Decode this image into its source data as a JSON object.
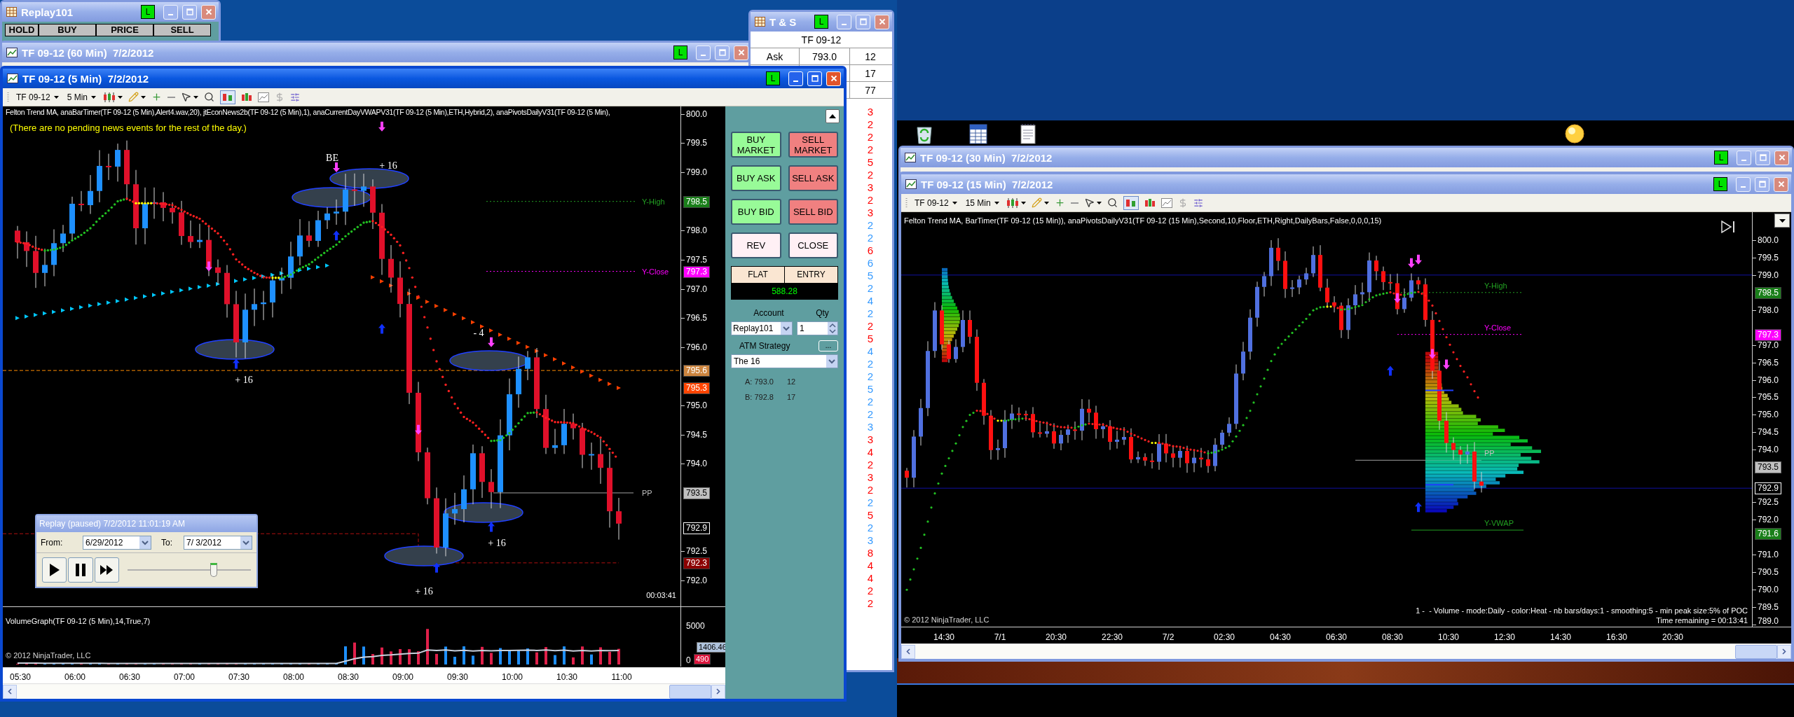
{
  "replay_account_window": {
    "title": "Replay101",
    "active": false,
    "link_button": "L",
    "columns": [
      "HOLD",
      "BUY",
      "PRICE",
      "SELL"
    ]
  },
  "chart_60min_window": {
    "title": "TF 09-12 (60 Min)  7/2/2012",
    "active": false,
    "link_button": "L"
  },
  "time_and_sales_window": {
    "title": "T & S",
    "active": false,
    "link_button": "L",
    "instrument": "TF 09-12",
    "quotes": [
      {
        "side": "Ask",
        "price": "793.0",
        "size": "12"
      },
      {
        "size": "17"
      },
      {
        "size": "77"
      }
    ],
    "trades": [
      {
        "size": "3",
        "color": "#ff0000"
      },
      {
        "size": "2",
        "color": "#ff0000"
      },
      {
        "size": "2",
        "color": "#ff0000"
      },
      {
        "size": "2",
        "color": "#ff0000"
      },
      {
        "size": "5",
        "color": "#ff0000"
      },
      {
        "size": "2",
        "color": "#ff0000"
      },
      {
        "size": "3",
        "color": "#ff0000"
      },
      {
        "size": "2",
        "color": "#ff0000"
      },
      {
        "size": "3",
        "color": "#ff0000"
      },
      {
        "size": "2",
        "color": "#3399ff"
      },
      {
        "size": "2",
        "color": "#3399ff"
      },
      {
        "size": "6",
        "color": "#ff0000"
      },
      {
        "size": "6",
        "color": "#3399ff"
      },
      {
        "size": "5",
        "color": "#3399ff"
      },
      {
        "size": "2",
        "color": "#3399ff"
      },
      {
        "size": "4",
        "color": "#3399ff"
      },
      {
        "size": "2",
        "color": "#3399ff"
      },
      {
        "size": "2",
        "color": "#ff0000"
      },
      {
        "size": "5",
        "color": "#ff0000"
      },
      {
        "size": "4",
        "color": "#3399ff"
      },
      {
        "size": "2",
        "color": "#3399ff"
      },
      {
        "size": "2",
        "color": "#3399ff"
      },
      {
        "size": "5",
        "color": "#3399ff"
      },
      {
        "size": "2",
        "color": "#3399ff"
      },
      {
        "size": "2",
        "color": "#3399ff"
      },
      {
        "size": "3",
        "color": "#3399ff"
      },
      {
        "size": "3",
        "color": "#ff0000"
      },
      {
        "size": "4",
        "color": "#ff0000"
      },
      {
        "size": "2",
        "color": "#ff0000"
      },
      {
        "size": "3",
        "color": "#ff0000"
      },
      {
        "size": "2",
        "color": "#ff0000"
      },
      {
        "size": "2",
        "color": "#3399ff"
      },
      {
        "size": "5",
        "color": "#ff0000"
      },
      {
        "size": "2",
        "color": "#3399ff"
      },
      {
        "size": "3",
        "color": "#3399ff"
      },
      {
        "size": "8",
        "color": "#ff0000"
      },
      {
        "size": "4",
        "color": "#ff0000"
      },
      {
        "size": "4",
        "color": "#ff0000"
      },
      {
        "size": "2",
        "color": "#ff0000"
      },
      {
        "size": "2",
        "color": "#ff0000"
      }
    ]
  },
  "chart_5min_window": {
    "title": "TF 09-12 (5 Min)  7/2/2012",
    "active": true,
    "link_button": "L",
    "instrument": "TF 09-12",
    "interval": "5 Min",
    "indicators": "Felton Trend MA, anaBarTimer(TF 09-12 (5 Min),Alert4.wav,20), jtEconNews2b(TF 09-12 (5 Min),1), anaCurrentDayVWAPV31(TF 09-12 (5 Min),ETH,Hybrid,2), anaPivotsDailyV31(TF 09-12 (5 Min),",
    "news": "(There are no pending news events for the rest of the day.)",
    "annotations": [
      "BE",
      "+ 16",
      "+ 16",
      "- 4",
      "+ 16",
      "+ 16"
    ],
    "level_labels": [
      "Y-High",
      "Y-Close",
      "PP"
    ],
    "bar_timer": "00:03:41",
    "price_ticks": [
      "800.0",
      "799.5",
      "799.0",
      "798.0",
      "797.5",
      "797.0",
      "796.5",
      "796.0",
      "795.0",
      "794.5",
      "794.0",
      "792.5",
      "792.0"
    ],
    "price_markers": [
      {
        "text": "798.5",
        "color": "#1a7f1a"
      },
      {
        "text": "797.3",
        "color": "#ff00ff"
      },
      {
        "text": "795.6",
        "color": "#cd853f"
      },
      {
        "text": "795.3",
        "color": "#ff4500"
      },
      {
        "text": "793.5",
        "color": "#c0c0c0"
      },
      {
        "text": "792.9",
        "color": "#000000"
      },
      {
        "text": "792.3",
        "color": "#8b0000"
      }
    ],
    "volume_label": "VolumeGraph(TF 09-12 (5 Min),14,True,7)",
    "volume_ticks": [
      "5000",
      "0"
    ],
    "volume_markers": [
      {
        "text": "1406.46",
        "color": "#b0c4de"
      },
      {
        "text": "490",
        "color": "#dc143c"
      }
    ],
    "copyright": "© 2012 NinjaTrader, LLC",
    "time_ticks": [
      "05:30",
      "06:00",
      "06:30",
      "07:00",
      "07:30",
      "08:00",
      "08:30",
      "09:00",
      "09:30",
      "10:00",
      "10:30",
      "11:00"
    ]
  },
  "order_panel": {
    "buttons": [
      {
        "label": "BUY MARKET",
        "kind": "buy"
      },
      {
        "label": "SELL MARKET",
        "kind": "sell"
      },
      {
        "label": "BUY ASK",
        "kind": "buy"
      },
      {
        "label": "SELL ASK",
        "kind": "sell"
      },
      {
        "label": "BUY BID",
        "kind": "buy"
      },
      {
        "label": "SELL BID",
        "kind": "sell"
      },
      {
        "label": "REV",
        "kind": "neutral"
      },
      {
        "label": "CLOSE",
        "kind": "neutral"
      }
    ],
    "position": "FLAT",
    "entry": "ENTRY",
    "pnl": "588.28",
    "account_label": "Account",
    "account": "Replay101",
    "qty_label": "Qty",
    "qty": "1",
    "atm_label": "ATM Strategy",
    "atm_more": "...",
    "atm_strategy": "The 16",
    "ask": "A: 793.0",
    "ask_size": "12",
    "bid": "B: 792.8",
    "bid_size": "17"
  },
  "replay_dialog": {
    "title": "Replay (paused) 7/2/2012 11:01:19 AM",
    "from_label": "From:",
    "from": "6/29/2012",
    "to_label": "To:",
    "to": "7/ 3/2012",
    "level": 0.7
  },
  "chart_30min_window": {
    "title": "TF 09-12 (30 Min)  7/2/2012",
    "active": false,
    "link_button": "L"
  },
  "chart_15min_window": {
    "title": "TF 09-12 (15 Min)  7/2/2012",
    "active": false,
    "link_button": "L",
    "instrument": "TF 09-12",
    "interval": "15 Min",
    "indicators": "Felton Trend MA, BarTimer(TF 09-12 (15 Min)), anaPivotsDailyV31(TF 09-12 (15 Min),Second,10,Floor,ETH,Right,DailyBars,False,0,0,0,15)",
    "level_labels": [
      "Y-High",
      "Y-Close",
      "PP",
      "Y-VWAP"
    ],
    "price_ticks": [
      "800.0",
      "799.5",
      "799.0",
      "798.0",
      "797.0",
      "796.5",
      "796.0",
      "795.5",
      "795.0",
      "794.5",
      "794.0",
      "792.5",
      "792.0",
      "791.0",
      "790.5",
      "790.0",
      "789.5",
      "789.0"
    ],
    "price_markers": [
      {
        "text": "798.5",
        "color": "#1a7f1a"
      },
      {
        "text": "797.3",
        "color": "#ff00ff"
      },
      {
        "text": "793.5",
        "color": "#c0c0c0"
      },
      {
        "text": "792.9",
        "color": "#000000"
      },
      {
        "text": "791.6",
        "color": "#1a7f1a"
      }
    ],
    "profile_info": "1 -  - Volume - mode:Daily - color:Heat - nb bars/days:1 - smoothing:5 - min peak size:5% of POC",
    "time_remaining": "Time remaining = 00:13:41",
    "copyright": "© 2012 NinjaTrader, LLC",
    "time_ticks": [
      "14:30",
      "7/1",
      "20:30",
      "22:30",
      "7/2",
      "02:30",
      "04:30",
      "06:30",
      "08:30",
      "10:30",
      "12:30",
      "14:30",
      "16:30",
      "20:30"
    ]
  }
}
